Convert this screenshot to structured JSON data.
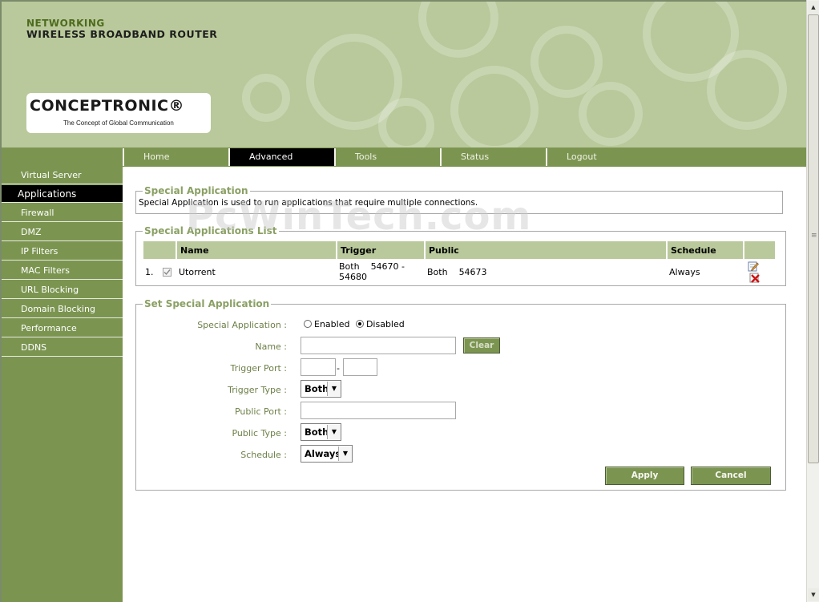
{
  "header": {
    "line1": "NETWORKING",
    "line2": "WIRELESS BROADBAND ROUTER",
    "logo_name": "CONCEPTRONIC®",
    "logo_tagline": "The Concept of Global Communication"
  },
  "nav": {
    "tabs": [
      "Home",
      "Advanced",
      "Tools",
      "Status",
      "Logout"
    ],
    "active": "Advanced"
  },
  "sidebar": {
    "items": [
      "Virtual Server",
      "Applications",
      "Firewall",
      "DMZ",
      "IP Filters",
      "MAC Filters",
      "URL Blocking",
      "Domain Blocking",
      "Performance",
      "DDNS"
    ],
    "active": "Applications"
  },
  "special_application": {
    "title": "Special Application",
    "description": "Special Application is used to run applications that require multiple connections."
  },
  "list": {
    "title": "Special Applications List",
    "headers": [
      "Name",
      "Trigger",
      "Public",
      "Schedule"
    ],
    "rows": [
      {
        "index": "1.",
        "enabled": true,
        "name": "Utorrent",
        "trigger_type": "Both",
        "trigger_range": "54670 - 54680",
        "public_type": "Both",
        "public_ports": "54673",
        "schedule": "Always"
      }
    ]
  },
  "form": {
    "title": "Set Special Application",
    "special_application_label": "Special Application :",
    "enabled_label": "Enabled",
    "disabled_label": "Disabled",
    "selected": "Disabled",
    "name_label": "Name :",
    "name_value": "",
    "clear_label": "Clear",
    "trigger_port_label": "Trigger Port :",
    "trigger_port_separator": "-",
    "trigger_type_label": "Trigger Type :",
    "trigger_type_value": "Both",
    "public_port_label": "Public Port :",
    "public_type_label": "Public Type :",
    "public_type_value": "Both",
    "schedule_label": "Schedule :",
    "schedule_value": "Always",
    "apply_label": "Apply",
    "cancel_label": "Cancel"
  },
  "watermark": "PcWinTech.com",
  "icons": {
    "edit": "edit-icon",
    "delete": "delete-icon"
  },
  "colors": {
    "header_bg": "#b9c99b",
    "nav_green": "#7b9551",
    "legend_green": "#8aa064",
    "active_black": "#000000"
  }
}
